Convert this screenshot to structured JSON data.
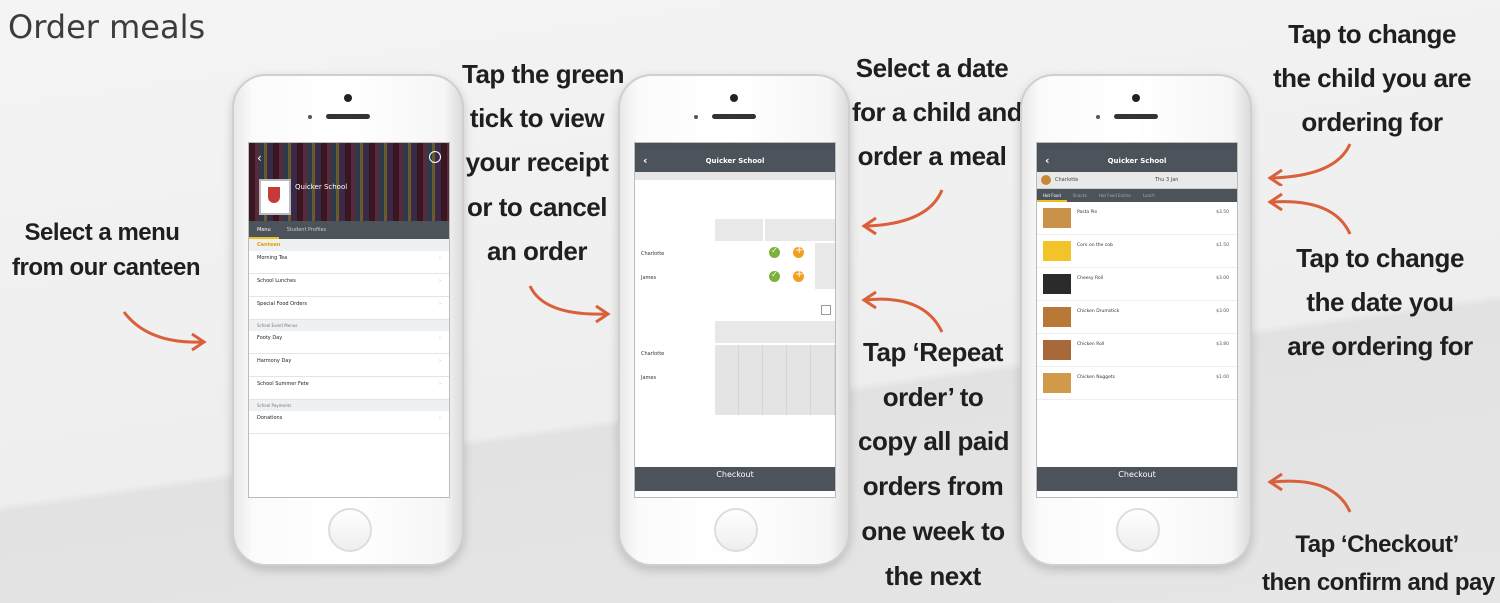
{
  "page": {
    "title": "Order meals"
  },
  "captions": {
    "select_menu": [
      "Select a menu",
      "from our canteen"
    ],
    "green_tick": [
      "Tap the green",
      "tick to view",
      "your receipt",
      "or to cancel",
      "an order"
    ],
    "select_date": [
      "Select a date",
      "for a child and",
      "order a meal"
    ],
    "repeat_order": [
      "Tap ‘Repeat",
      "order’ to",
      "copy all paid",
      "orders from",
      "one week to",
      "the next"
    ],
    "change_child": [
      "Tap to change",
      "the child you are",
      "ordering for"
    ],
    "change_date": [
      "Tap to change",
      "the date you",
      "are ordering for"
    ],
    "checkout": [
      "Tap ‘Checkout’",
      "then confirm and pay"
    ]
  },
  "phone1": {
    "school_name": "Quicker School",
    "tabs": [
      "Menu",
      "Student Profiles"
    ],
    "sections": [
      {
        "heading": "Canteen",
        "items": [
          "Morning Tea",
          "School Lunches",
          "Special Food Orders"
        ]
      },
      {
        "heading": "School Event Menus",
        "items": [
          "Footy Day",
          "Harmony Day",
          "School Summer Fete"
        ]
      },
      {
        "heading": "School Payments",
        "items": [
          "Donations"
        ]
      }
    ]
  },
  "phone2": {
    "nav_title": "Quicker School",
    "children": [
      "Charlotte",
      "James"
    ],
    "checkout_label": "Checkout"
  },
  "phone3": {
    "nav_title": "Quicker School",
    "child": "Charlotte",
    "date": "Thu 3 Jan",
    "tabs": [
      "Hot Food",
      "Snacks",
      "Hot Food Extras",
      "Lunch"
    ],
    "items": [
      {
        "name": "Pasta Pie",
        "price": "$3.50",
        "color": "#c8924a"
      },
      {
        "name": "Corn on the cob",
        "price": "$1.50",
        "color": "#f2c42a"
      },
      {
        "name": "Cheesy Roll",
        "price": "$3.00",
        "color": "#2b2b2b"
      },
      {
        "name": "Chicken Drumstick",
        "price": "$3.00",
        "color": "#b77838"
      },
      {
        "name": "Chicken Roll",
        "price": "$3.80",
        "color": "#a8693a"
      },
      {
        "name": "Chicken Nuggets",
        "price": "$1.00",
        "color": "#d09a4a"
      }
    ],
    "checkout_label": "Checkout"
  },
  "colors": {
    "accent_yellow": "#f5c51a",
    "tick_green": "#7ab23c",
    "arrow_red": "#d9603b",
    "nav_gray": "#4c535b"
  }
}
